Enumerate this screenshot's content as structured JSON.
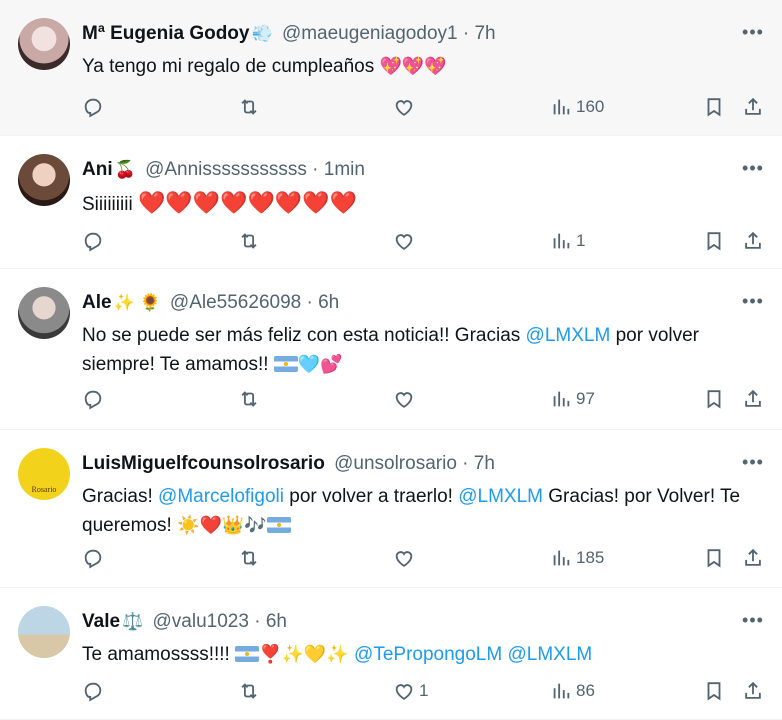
{
  "tweets": [
    {
      "name": "Mª Eugenia Godoy",
      "badge": "💨",
      "handle": "@maeugeniagodoy1",
      "time": "7h",
      "text": "Ya tengo mi regalo de cumpleaños",
      "emojis": "💖💖💖",
      "replies": "",
      "retweets": "",
      "likes": "",
      "views": "160",
      "avatar_color": "#c9a9a6"
    },
    {
      "name": "Ani",
      "badge": "🍒",
      "handle": "@Annisssssssssss",
      "time": "1min",
      "text": "Siiiiiiiii",
      "emojis": "❤️❤️❤️❤️❤️❤️❤️❤️",
      "replies": "",
      "retweets": "",
      "likes": "",
      "views": "1",
      "avatar_color": "#6b4a3a"
    },
    {
      "name": "Ale",
      "badge": "✨ 🌻",
      "handle": "@Ale55626098",
      "time": "6h",
      "text_before": "No se puede ser más feliz con esta noticia!! Gracias",
      "mention": "@LMXLM",
      "text_after": "por volver siempre! Te amamos!!",
      "emojis": "🩵💕",
      "replies": "",
      "retweets": "",
      "likes": "",
      "views": "97",
      "avatar_color": "#8a8a8a"
    },
    {
      "name": "LuisMiguelfcounsolrosario",
      "handle": "@unsolrosario",
      "time": "7h",
      "text_a": "Gracias!",
      "mention_a": "@Marcelofigoli",
      "text_b": "por volver a traerlo!",
      "mention_b": "@LMXLM",
      "text_c": "Gracias! por Volver! Te queremos!",
      "emojis": "☀️❤️👑🎶",
      "replies": "",
      "retweets": "",
      "likes": "",
      "views": "185",
      "avatar_label": "Rosario",
      "avatar_color": "#f2d21a"
    },
    {
      "name": "Vale",
      "badge": "⚖️",
      "handle": "@valu1023",
      "time": "6h",
      "text": "Te amamossss!!!!",
      "emojis": "❣️✨💛✨",
      "mention_a": "@TePropongoLM",
      "mention_b": "@LMXLM",
      "replies": "",
      "retweets": "",
      "likes": "1",
      "views": "86",
      "avatar_color": "#9bb8c9"
    }
  ],
  "icons": {
    "reply": "reply-icon",
    "retweet": "retweet-icon",
    "like": "heart-icon",
    "views": "views-chart-icon",
    "bookmark": "bookmark-icon",
    "share": "share-icon",
    "more": "more-icon"
  },
  "colors": {
    "link": "#1d9bf0",
    "muted": "#536471",
    "shaded_row": "#f7f7f7"
  }
}
